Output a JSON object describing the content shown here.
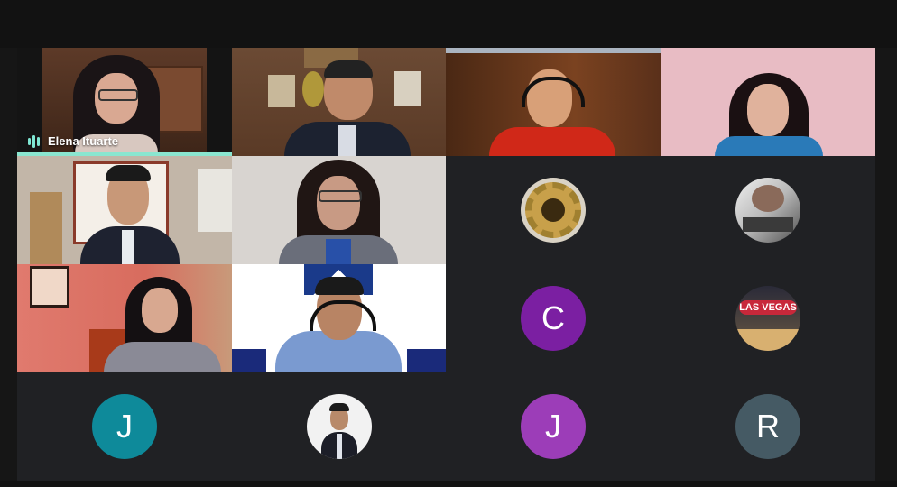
{
  "participants": [
    {
      "name": "Elena Ituarte",
      "speaking": true
    },
    {
      "name": ""
    },
    {
      "name": ""
    },
    {
      "name": ""
    },
    {
      "name": ""
    },
    {
      "name": ""
    },
    {
      "name": "",
      "avatar": "gear-emblem-icon"
    },
    {
      "name": "",
      "avatar": "photo"
    },
    {
      "name": ""
    },
    {
      "name": ""
    },
    {
      "name": "",
      "initial": "C",
      "color": "#7b1fa2"
    },
    {
      "name": "",
      "avatar": "las-vegas-sign-photo",
      "sign_text": "LAS VEGAS"
    },
    {
      "name": "",
      "initial": "J",
      "color": "#0e8a9a"
    },
    {
      "name": "",
      "avatar": "photo"
    },
    {
      "name": "",
      "initial": "J",
      "color": "#9c3db8"
    },
    {
      "name": "",
      "initial": "R",
      "color": "#455a64"
    }
  ],
  "colors": {
    "speaking_indicator": "#8ae6d0",
    "background": "#202124"
  }
}
